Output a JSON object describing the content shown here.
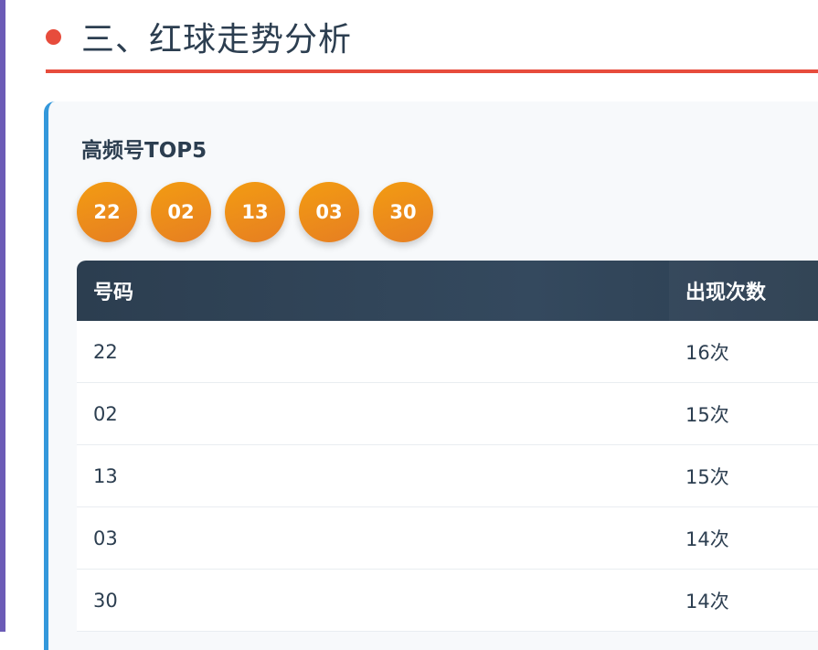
{
  "section": {
    "title": "三、红球走势分析"
  },
  "card": {
    "title": "高频号TOP5",
    "balls": [
      "22",
      "02",
      "13",
      "03",
      "30"
    ],
    "table": {
      "headers": [
        "号码",
        "出现次数"
      ],
      "rows": [
        [
          "22",
          "16次"
        ],
        [
          "02",
          "15次"
        ],
        [
          "13",
          "15次"
        ],
        [
          "03",
          "14次"
        ],
        [
          "30",
          "14次"
        ]
      ]
    }
  },
  "colors": {
    "accent_red": "#e74c3c",
    "accent_blue": "#3498db",
    "ball_orange": "#f39c12",
    "header_dark": "#2c3e50",
    "left_bar": "#6b5bb6"
  }
}
